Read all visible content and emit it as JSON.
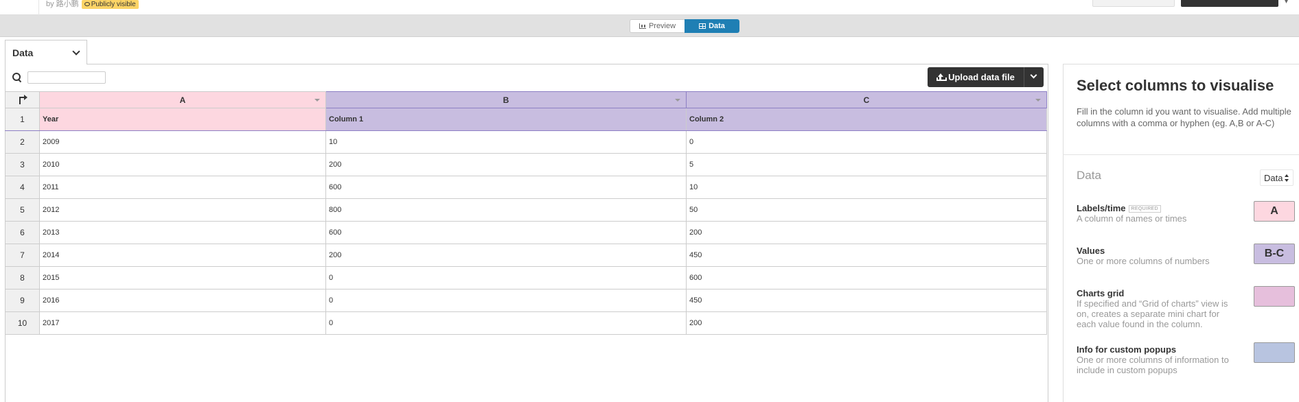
{
  "header": {
    "byline": "by 路小鹏",
    "badge": "Publicly visible"
  },
  "view_toggle": {
    "preview_label": "Preview",
    "data_label": "Data",
    "active": "Data"
  },
  "data_tab": {
    "label": "Data"
  },
  "search": {
    "value": "",
    "placeholder": ""
  },
  "upload": {
    "label": "Upload data file"
  },
  "table": {
    "columns": [
      "A",
      "B",
      "C"
    ],
    "rows": [
      {
        "n": "1",
        "a": "Year",
        "b": "Column 1",
        "c": "Column 2"
      },
      {
        "n": "2",
        "a": "2009",
        "b": "10",
        "c": "0"
      },
      {
        "n": "3",
        "a": "2010",
        "b": "200",
        "c": "5"
      },
      {
        "n": "4",
        "a": "2011",
        "b": "600",
        "c": "10"
      },
      {
        "n": "5",
        "a": "2012",
        "b": "800",
        "c": "50"
      },
      {
        "n": "6",
        "a": "2013",
        "b": "600",
        "c": "200"
      },
      {
        "n": "7",
        "a": "2014",
        "b": "200",
        "c": "450"
      },
      {
        "n": "8",
        "a": "2015",
        "b": "0",
        "c": "600"
      },
      {
        "n": "9",
        "a": "2016",
        "b": "0",
        "c": "450"
      },
      {
        "n": "10",
        "a": "2017",
        "b": "0",
        "c": "200"
      }
    ]
  },
  "colors": {
    "labels": "#fdd7e0",
    "values": "#c8bde0",
    "grid": "#e6bfdc",
    "popups": "#b8c4e0",
    "accent": "#1f7fb4"
  },
  "side_panel": {
    "title": "Select columns to visualise",
    "description": "Fill in the column id you want to visualise. Add multiple columns with a comma or hyphen (eg. A,B or A-C)",
    "section": "Data",
    "select_value": "Data",
    "fields": {
      "labels": {
        "label": "Labels/time",
        "required": "REQUIRED",
        "help": "A column of names or times",
        "value": "A"
      },
      "values": {
        "label": "Values",
        "help": "One or more columns of numbers",
        "value": "B-C"
      },
      "grid": {
        "label": "Charts grid",
        "help": "If specified and “Grid of charts” view is on, creates a separate mini chart for each value found in the column.",
        "value": ""
      },
      "popups": {
        "label": "Info for custom popups",
        "help": "One or more columns of information to include in custom popups",
        "value": ""
      }
    }
  }
}
